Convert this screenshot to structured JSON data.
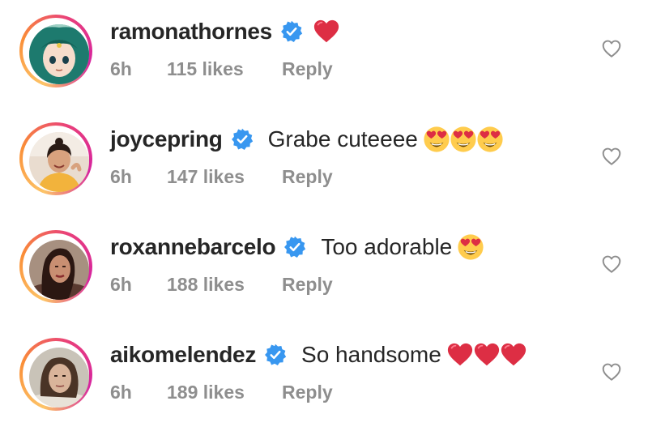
{
  "comments": [
    {
      "username": "ramonathornes",
      "text": "",
      "emojis": [
        "heart-red"
      ],
      "time": "6h",
      "likes": "115 likes",
      "reply": "Reply"
    },
    {
      "username": "joycepring",
      "text": "Grabe cuteeee",
      "emojis": [
        "heart-eyes",
        "heart-eyes",
        "heart-eyes"
      ],
      "time": "6h",
      "likes": "147 likes",
      "reply": "Reply"
    },
    {
      "username": "roxannebarcelo",
      "text": "Too adorable",
      "emojis": [
        "heart-eyes"
      ],
      "time": "6h",
      "likes": "188 likes",
      "reply": "Reply"
    },
    {
      "username": "aikomelendez",
      "text": "So handsome",
      "emojis": [
        "heart-red",
        "heart-red",
        "heart-red"
      ],
      "time": "6h",
      "likes": "189 likes",
      "reply": "Reply"
    }
  ],
  "colors": {
    "username": "#262626",
    "meta": "#8e8e8e",
    "verified": "#3897f0",
    "heart": "#e0245e"
  }
}
